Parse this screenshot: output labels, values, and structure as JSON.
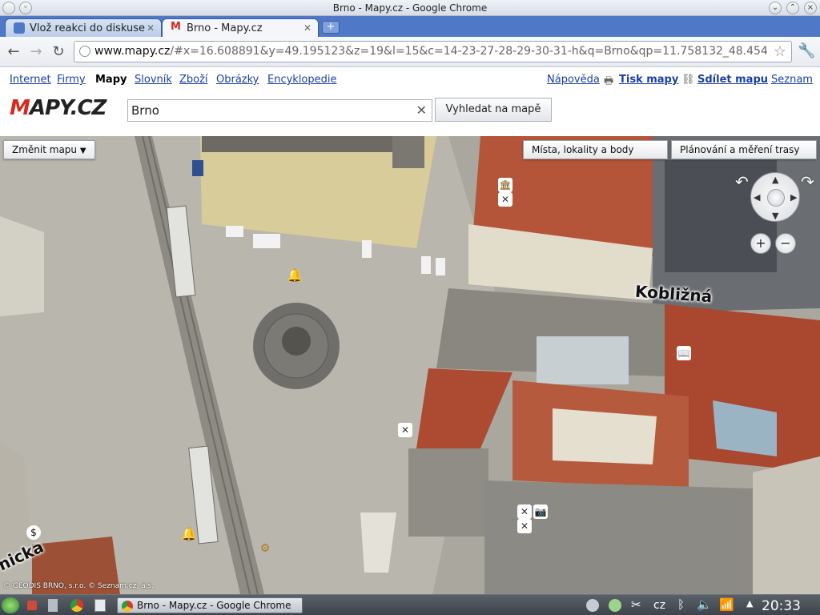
{
  "window": {
    "title": "Brno - Mapy.cz - Google Chrome"
  },
  "tabs": [
    {
      "label": "Vlož reakci do diskuse",
      "active": false
    },
    {
      "label": "Brno - Mapy.cz",
      "active": true
    }
  ],
  "omnibox": {
    "host": "www.mapy.cz",
    "path": "/#x=16.608891&y=49.195123&z=19&l=15&c=14-23-27-28-29-30-31-h&q=Brno&qp=11.758132_48.454"
  },
  "header": {
    "services": [
      "Internet",
      "Firmy",
      "Mapy",
      "Slovník",
      "Zboží",
      "Obrázky",
      "Encyklopedie"
    ],
    "current_service": "Mapy",
    "help": "Nápověda",
    "print": "Tisk mapy",
    "share": "Sdílet mapu",
    "seznam": "Seznam",
    "logo_red": "M",
    "logo_rest": "APY.CZ"
  },
  "search": {
    "value": "Brno",
    "button": "Vyhledat na mapě"
  },
  "map": {
    "change_map": "Změnit mapu",
    "places_button": "Místa, lokality a body",
    "planning_button": "Plánování a měření trasy",
    "street_1": "Kobližná",
    "street_2": "nicka",
    "copyright": "© GEODIS BRNO, s.r.o. © Seznam.cz, a.s.",
    "zoom_in": "+",
    "zoom_out": "−"
  },
  "taskbar": {
    "task": "Brno - Mapy.cz - Google Chrome",
    "lang": "cz",
    "clock": "20:33"
  },
  "colors": {
    "accent": "#4f79c7",
    "logo": "#d52b1e",
    "link": "#1a3ea8"
  }
}
